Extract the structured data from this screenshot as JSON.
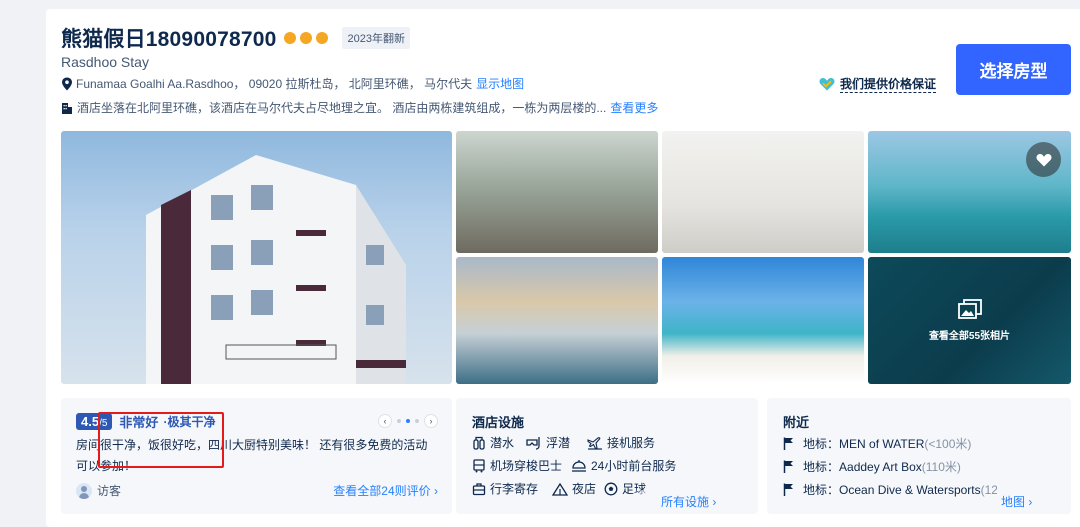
{
  "hotel": {
    "name": "熊猫假日18090078700",
    "star_count": 3,
    "renovation_badge": "2023年翻新",
    "english_name": "Rasdhoo Stay",
    "address": "Funamaa Goalhi Aa.Rasdhoo， 09020 拉斯杜岛， 北阿里环礁， 马尔代夫",
    "show_map_label": "显示地图",
    "description": "酒店坐落在北阿里环礁，该酒店在马尔代夫占尽地理之宜。 酒店由两栋建筑组成，一栋为两层楼的...",
    "see_more_label": "查看更多",
    "price_guarantee": "我们提供价格保证",
    "select_room_label": "选择房型"
  },
  "gallery": {
    "view_all_label": "查看全部55张相片",
    "icons": {
      "favorite": "heart-icon",
      "photos": "image-stack-icon"
    }
  },
  "review": {
    "score": "4.5",
    "score_max": "/5",
    "rating_word": "非常好",
    "highlight_tag": "极其干净",
    "text": "房间很干净，饭很好吃，四川大厨特别美味！ 还有很多免费的活动可以参加！",
    "reviewer": "访客",
    "all_reviews_label": "查看全部24则评价",
    "page_count": 3,
    "active_page": 1
  },
  "facilities": {
    "title": "酒店设施",
    "items": [
      {
        "label": "潜水",
        "icon": "diving-tank-icon"
      },
      {
        "label": "浮潜",
        "icon": "snorkel-mask-icon"
      },
      {
        "label": "接机服务",
        "icon": "airport-pickup-icon"
      },
      {
        "label": "机场穿梭巴士",
        "icon": "shuttle-bus-icon"
      },
      {
        "label": "24小时前台服务",
        "icon": "front-desk-icon"
      },
      {
        "label": "行李寄存",
        "icon": "luggage-icon"
      },
      {
        "label": "夜店",
        "icon": "nightclub-icon"
      },
      {
        "label": "足球",
        "icon": "football-icon"
      }
    ],
    "all_label": "所有设施"
  },
  "nearby": {
    "title": "附近",
    "items": [
      {
        "type": "地标",
        "name": "MEN of WATER",
        "distance": "(<100米)"
      },
      {
        "type": "地标",
        "name": "Aaddey Art Box",
        "distance": "(110米)"
      },
      {
        "type": "地标",
        "name": "Ocean Dive & Watersports",
        "distance": "(12"
      }
    ],
    "map_label": "地图"
  },
  "colors": {
    "primary_button": "#3264ff",
    "link": "#2681ff",
    "score_blue": "#2d58b4",
    "star": "#f5a623",
    "highlight_border": "#e31b1b"
  }
}
